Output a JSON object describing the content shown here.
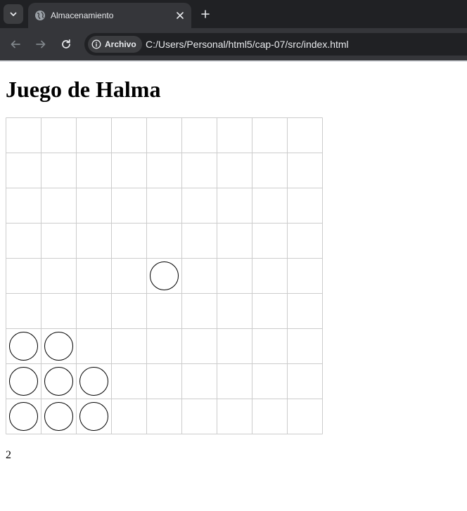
{
  "browser": {
    "tab": {
      "title": "Almacenamiento"
    },
    "address": {
      "site_chip": "Archivo",
      "url": "C:/Users/Personal/html5/cap-07/src/index.html"
    }
  },
  "page": {
    "title": "Juego de Halma",
    "move_count": "2"
  },
  "board": {
    "columns": 9,
    "rows": 9,
    "pieces": [
      {
        "col": 4,
        "row": 4
      },
      {
        "col": 0,
        "row": 6
      },
      {
        "col": 1,
        "row": 6
      },
      {
        "col": 0,
        "row": 7
      },
      {
        "col": 1,
        "row": 7
      },
      {
        "col": 2,
        "row": 7
      },
      {
        "col": 0,
        "row": 8
      },
      {
        "col": 1,
        "row": 8
      },
      {
        "col": 2,
        "row": 8
      }
    ],
    "grid_color": "#cccccc",
    "piece_color": "#000000"
  },
  "icons": {
    "tab_search": "chevron-down-icon",
    "favicon": "globe-icon",
    "tab_close": "close-icon",
    "new_tab": "plus-icon",
    "back": "back-arrow-icon",
    "forward": "forward-arrow-icon",
    "reload": "reload-icon",
    "site_info": "info-icon"
  }
}
